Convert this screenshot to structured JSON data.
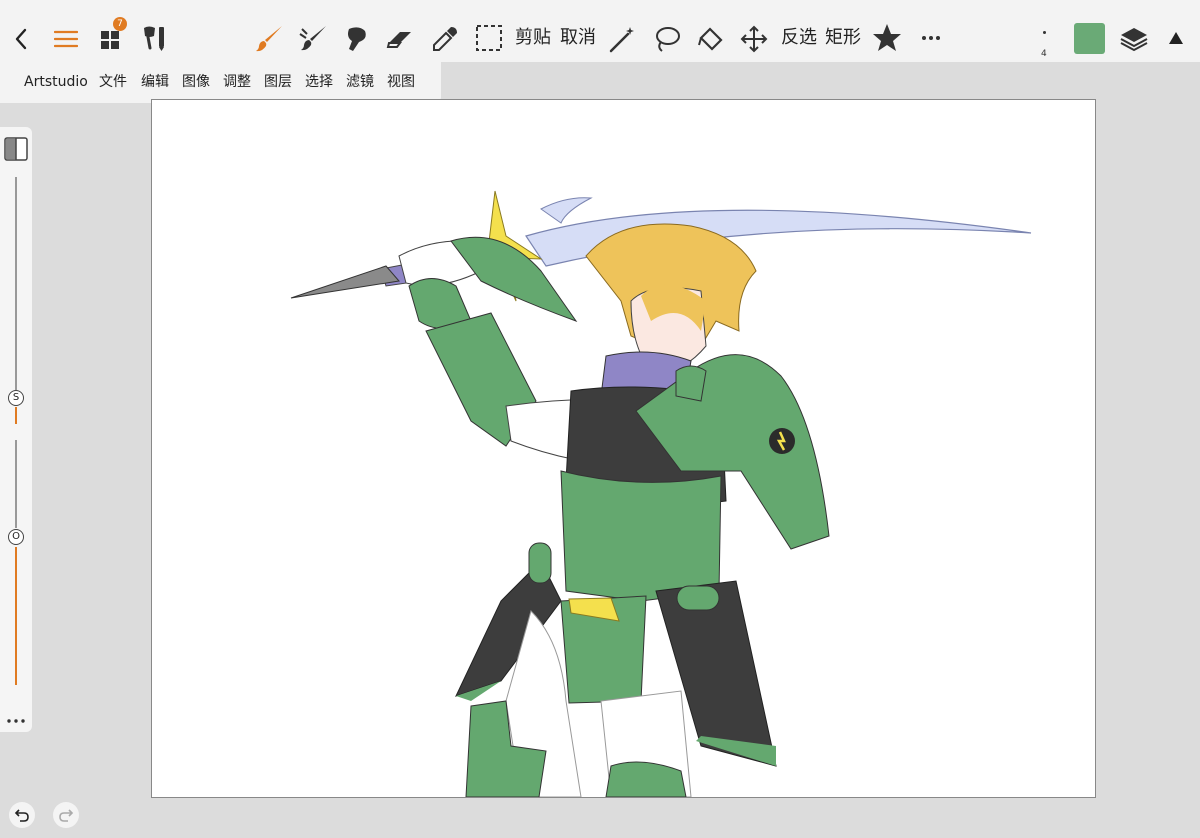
{
  "toolbar": {
    "layers_badge": "7",
    "paste_label": "剪贴",
    "cancel_label": "取消",
    "invert_label": "反选",
    "rect_label": "矩形",
    "brush_size_value": "4",
    "current_color": "#6aaa76",
    "accent_color": "#e07b22"
  },
  "menu": {
    "app_name": "Artstudio",
    "items": [
      "文件",
      "编辑",
      "图像",
      "调整",
      "图层",
      "选择",
      "滤镜",
      "视图"
    ]
  },
  "sidebar": {
    "size_label": "S",
    "opacity_label": "O"
  },
  "icons": [
    "back-icon",
    "hamburger-icon",
    "layers-grid-icon",
    "brush-settings-icon",
    "brush-icon",
    "smudge-icon",
    "blob-brush-icon",
    "eraser-icon",
    "eyedropper-icon",
    "selection-icon",
    "magic-wand-icon",
    "lasso-icon",
    "fill-icon",
    "move-icon",
    "star-icon",
    "more-icon",
    "layers-icon",
    "collapse-icon",
    "undo-icon",
    "redo-icon"
  ]
}
